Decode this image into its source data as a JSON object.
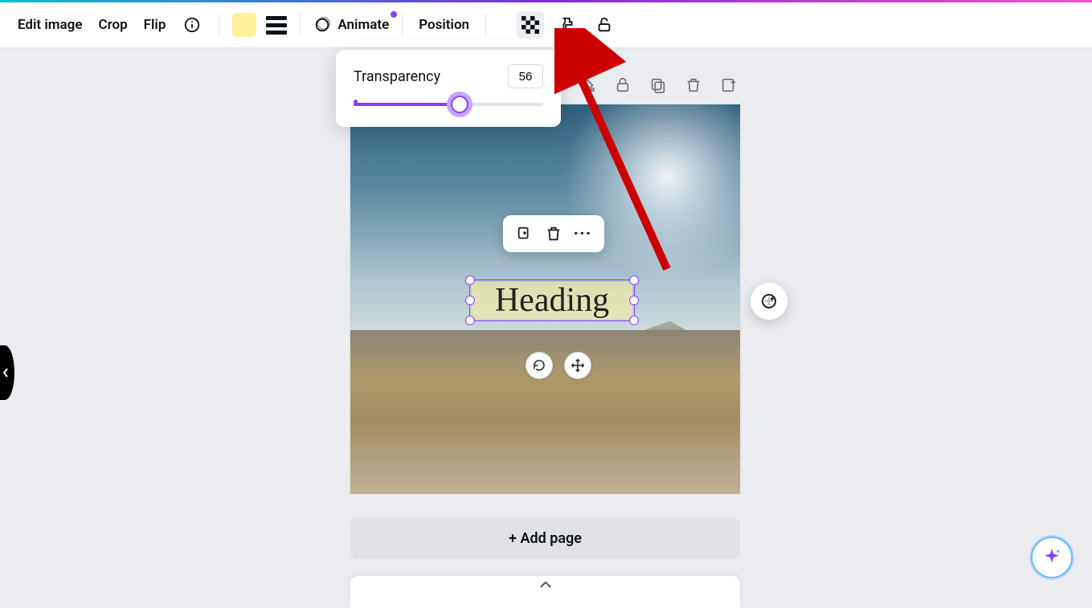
{
  "toolbar": {
    "edit_image": "Edit image",
    "crop": "Crop",
    "flip": "Flip",
    "animate": "Animate",
    "position": "Position",
    "fill_color": "#fdf29b"
  },
  "transparency": {
    "label": "Transparency",
    "value": "56"
  },
  "canvas": {
    "heading_text": "Heading"
  },
  "actions": {
    "add_page": "+ Add page"
  }
}
